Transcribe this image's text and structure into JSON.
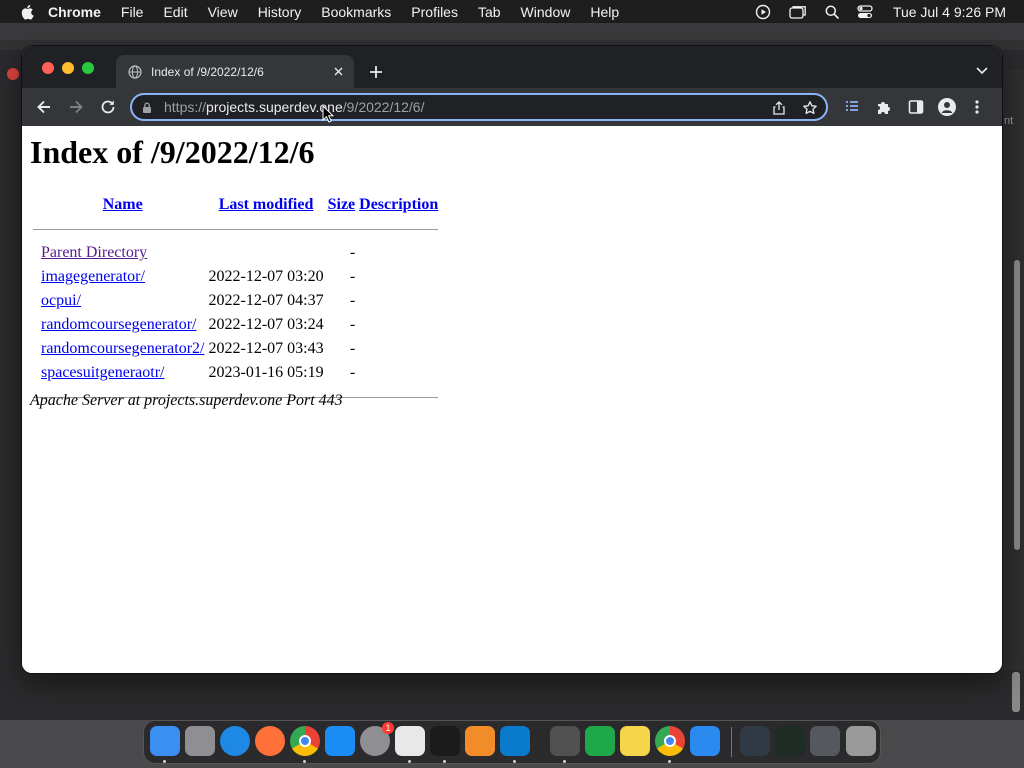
{
  "menubar": {
    "app_name": "Chrome",
    "items": [
      "File",
      "Edit",
      "View",
      "History",
      "Bookmarks",
      "Profiles",
      "Tab",
      "Window",
      "Help"
    ],
    "clock": "Tue Jul 4  9:26 PM"
  },
  "background": {
    "right_edge_text": "nt"
  },
  "browser": {
    "tab_title": "Index of /9/2022/12/6",
    "url": {
      "scheme": "https://",
      "host": "projects.superdev.one",
      "path": "/9/2022/12/6/"
    }
  },
  "page": {
    "heading": "Index of /9/2022/12/6",
    "columns": {
      "name": "Name",
      "last_modified": "Last modified",
      "size": "Size",
      "description": "Description"
    },
    "rows": [
      {
        "name": "Parent Directory",
        "modified": "",
        "size": "-",
        "visited": true
      },
      {
        "name": "imagegenerator/",
        "modified": "2022-12-07 03:20",
        "size": "-",
        "visited": false
      },
      {
        "name": "ocpui/",
        "modified": "2022-12-07 04:37",
        "size": "-",
        "visited": false
      },
      {
        "name": "randomcoursegenerator/",
        "modified": "2022-12-07 03:24",
        "size": "-",
        "visited": false
      },
      {
        "name": "randomcoursegenerator2/",
        "modified": "2022-12-07 03:43",
        "size": "-",
        "visited": false
      },
      {
        "name": "spacesuitgeneraotr/",
        "modified": "2023-01-16 05:19",
        "size": "-",
        "visited": false
      }
    ],
    "footer": "Apache Server at projects.superdev.one Port 443"
  },
  "dock": {
    "apps": [
      {
        "icon": "finder-icon",
        "color": "#3b8ff0",
        "running": true
      },
      {
        "icon": "launchpad-icon",
        "color": "#8e8e93",
        "running": false
      },
      {
        "icon": "safari-icon",
        "color": "#1e88e5",
        "running": false
      },
      {
        "icon": "firefox-icon",
        "color": "#ff7139",
        "running": false
      },
      {
        "icon": "chrome-icon",
        "color": "#34a853",
        "running": true
      },
      {
        "icon": "app-store-icon",
        "color": "#1c8cf5",
        "running": false
      },
      {
        "icon": "system-settings-icon",
        "color": "#8e8e93",
        "running": false,
        "badge": "1"
      },
      {
        "icon": "textedit-icon",
        "color": "#e8e8e8",
        "running": true
      },
      {
        "icon": "terminal-icon",
        "color": "#1b1b1b",
        "running": true
      },
      {
        "icon": "garageband-icon",
        "color": "#f28c28",
        "running": false
      },
      {
        "icon": "vscode-icon",
        "color": "#0a7acc",
        "running": true
      },
      {
        "icon": "calculator-icon",
        "color": "#505050",
        "running": true
      },
      {
        "icon": "numbers-icon",
        "color": "#1fa84a",
        "running": false
      },
      {
        "icon": "notes-icon",
        "color": "#f7d54a",
        "running": false
      },
      {
        "icon": "chrome-icon",
        "color": "#34a853",
        "running": true
      },
      {
        "icon": "keynote-icon",
        "color": "#2b8af0",
        "running": false
      },
      {
        "icon": "minimized-window-icon",
        "color": "#2f3a45",
        "running": false
      },
      {
        "icon": "minimized-window-icon",
        "color": "#1f2b25",
        "running": false
      },
      {
        "icon": "minimized-window-icon",
        "color": "#55585c",
        "running": false
      },
      {
        "icon": "trash-icon",
        "color": "#9a9a9a",
        "running": false
      }
    ]
  }
}
